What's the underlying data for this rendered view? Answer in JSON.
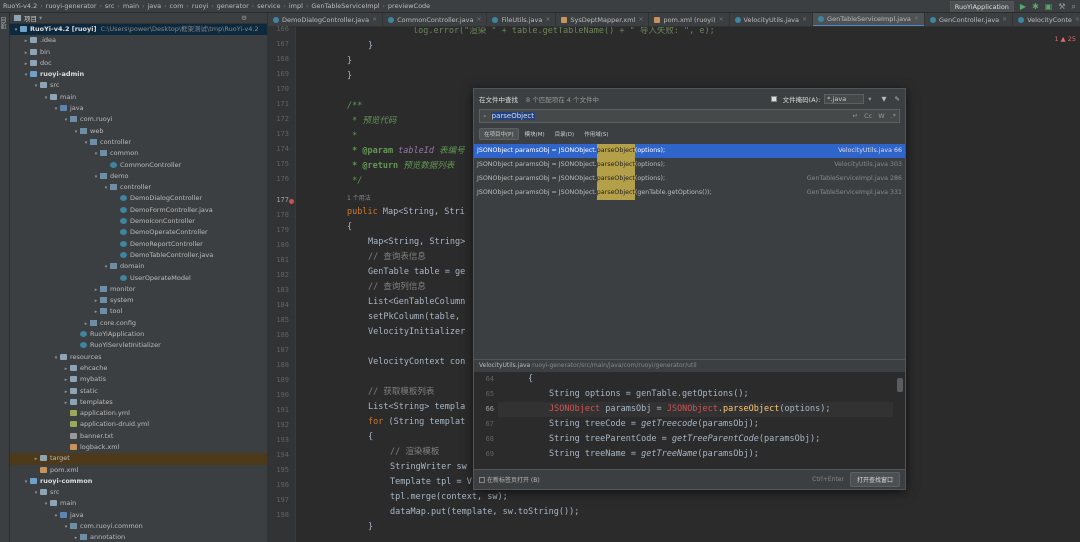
{
  "breadcrumbs": [
    "RuoYi-v4.2",
    "ruoyi-generator",
    "src",
    "main",
    "java",
    "com",
    "ruoyi",
    "generator",
    "service",
    "impl",
    "GenTableServiceImpl",
    "previewCode"
  ],
  "run_config": "RuoYiApplication",
  "project": {
    "header": "项目",
    "rows": [
      {
        "indent": 0,
        "arrow": "▾",
        "icon": "mod",
        "label": "RuoYi-v4.2 [ruoyi]",
        "extra": "C:\\Users\\power\\Desktop\\框架测试\\tmp\\RuoYi-v4.2",
        "bold": true,
        "selected": true
      },
      {
        "indent": 1,
        "arrow": "▸",
        "icon": "folder",
        "label": ".idea"
      },
      {
        "indent": 1,
        "arrow": "▸",
        "icon": "folder",
        "label": "bin"
      },
      {
        "indent": 1,
        "arrow": "▸",
        "icon": "folder",
        "label": "doc"
      },
      {
        "indent": 1,
        "arrow": "▾",
        "icon": "mod",
        "label": "ruoyi-admin",
        "bold": true
      },
      {
        "indent": 2,
        "arrow": "▾",
        "icon": "folder",
        "label": "src"
      },
      {
        "indent": 3,
        "arrow": "▾",
        "icon": "folder",
        "label": "main"
      },
      {
        "indent": 4,
        "arrow": "▾",
        "icon": "src",
        "label": "java"
      },
      {
        "indent": 5,
        "arrow": "▾",
        "icon": "pkg",
        "label": "com.ruoyi"
      },
      {
        "indent": 6,
        "arrow": "▾",
        "icon": "pkg",
        "label": "web"
      },
      {
        "indent": 7,
        "arrow": "▾",
        "icon": "pkg",
        "label": "controller"
      },
      {
        "indent": 8,
        "arrow": "▾",
        "icon": "pkg",
        "label": "common"
      },
      {
        "indent": 9,
        "arrow": "",
        "icon": "cls",
        "label": "CommonController"
      },
      {
        "indent": 8,
        "arrow": "▾",
        "icon": "pkg",
        "label": "demo"
      },
      {
        "indent": 9,
        "arrow": "▾",
        "icon": "pkg",
        "label": "controller"
      },
      {
        "indent": 10,
        "arrow": "",
        "icon": "cls",
        "label": "DemoDialogController"
      },
      {
        "indent": 10,
        "arrow": "",
        "icon": "cls",
        "label": "DemoFormController.java"
      },
      {
        "indent": 10,
        "arrow": "",
        "icon": "cls",
        "label": "DemoIconController"
      },
      {
        "indent": 10,
        "arrow": "",
        "icon": "cls",
        "label": "DemoOperateController"
      },
      {
        "indent": 10,
        "arrow": "",
        "icon": "cls",
        "label": "DemoReportController"
      },
      {
        "indent": 10,
        "arrow": "",
        "icon": "cls",
        "label": "DemoTableController.java"
      },
      {
        "indent": 9,
        "arrow": "▾",
        "icon": "pkg",
        "label": "domain"
      },
      {
        "indent": 10,
        "arrow": "",
        "icon": "cls",
        "label": "UserOperateModel"
      },
      {
        "indent": 8,
        "arrow": "▸",
        "icon": "pkg",
        "label": "monitor"
      },
      {
        "indent": 8,
        "arrow": "▸",
        "icon": "pkg",
        "label": "system"
      },
      {
        "indent": 8,
        "arrow": "▸",
        "icon": "pkg",
        "label": "tool"
      },
      {
        "indent": 7,
        "arrow": "▸",
        "icon": "pkg",
        "label": "core.config"
      },
      {
        "indent": 6,
        "arrow": "",
        "icon": "cls",
        "label": "RuoYiApplication"
      },
      {
        "indent": 6,
        "arrow": "",
        "icon": "cls",
        "label": "RuoYiServletInitializer"
      },
      {
        "indent": 4,
        "arrow": "▾",
        "icon": "folder",
        "label": "resources"
      },
      {
        "indent": 5,
        "arrow": "▸",
        "icon": "folder",
        "label": "ehcache"
      },
      {
        "indent": 5,
        "arrow": "▸",
        "icon": "folder",
        "label": "mybatis"
      },
      {
        "indent": 5,
        "arrow": "▸",
        "icon": "folder",
        "label": "static"
      },
      {
        "indent": 5,
        "arrow": "▸",
        "icon": "folder",
        "label": "templates"
      },
      {
        "indent": 5,
        "arrow": "",
        "icon": "yml",
        "label": "application.yml"
      },
      {
        "indent": 5,
        "arrow": "",
        "icon": "yml",
        "label": "application-druid.yml"
      },
      {
        "indent": 5,
        "arrow": "",
        "icon": "txt",
        "label": "banner.txt"
      },
      {
        "indent": 5,
        "arrow": "",
        "icon": "xml",
        "label": "logback.xml"
      },
      {
        "indent": 2,
        "arrow": "▸",
        "icon": "folder",
        "label": "target",
        "highlight": true
      },
      {
        "indent": 2,
        "arrow": "",
        "icon": "xml",
        "label": "pom.xml"
      },
      {
        "indent": 1,
        "arrow": "▾",
        "icon": "mod",
        "label": "ruoyi-common",
        "bold": true
      },
      {
        "indent": 2,
        "arrow": "▾",
        "icon": "folder",
        "label": "src"
      },
      {
        "indent": 3,
        "arrow": "▾",
        "icon": "folder",
        "label": "main"
      },
      {
        "indent": 4,
        "arrow": "▾",
        "icon": "src",
        "label": "java"
      },
      {
        "indent": 5,
        "arrow": "▾",
        "icon": "pkg",
        "label": "com.ruoyi.common"
      },
      {
        "indent": 6,
        "arrow": "▸",
        "icon": "pkg",
        "label": "annotation"
      }
    ]
  },
  "tabs": [
    {
      "label": "DemoDialogController.java",
      "type": "java"
    },
    {
      "label": "CommonController.java",
      "type": "java"
    },
    {
      "label": "FileUtils.java",
      "type": "java"
    },
    {
      "label": "SysDeptMapper.xml",
      "type": "xml"
    },
    {
      "label": "pom.xml (ruoyi)",
      "type": "xml"
    },
    {
      "label": "VelocityUtils.java",
      "type": "java"
    },
    {
      "label": "GenTableServiceImpl.java",
      "type": "java",
      "active": true
    },
    {
      "label": "GenController.java",
      "type": "java"
    },
    {
      "label": "VelocityConte",
      "type": "java"
    }
  ],
  "warning_count": "1 ▲ 25",
  "line_numbers": [
    "166",
    "167",
    "168",
    "169",
    "170",
    "171",
    "172",
    "173",
    "174",
    "175",
    "176",
    "177",
    "178",
    "179",
    "180",
    "181",
    "182",
    "183",
    "184",
    "185",
    "186",
    "187",
    "188",
    "189",
    "190",
    "191",
    "192",
    "193",
    "194",
    "195",
    "196",
    "197",
    "198"
  ],
  "current_line": "177",
  "usages_hint": "1 个用法",
  "code": {
    "l166": "log.error(\"渲染 \" + table.getTableName() + \" 导入失败: \", e);",
    "l167": "}",
    "l168": "}",
    "l171_open": "/**",
    "l172": " * 预览代码",
    "l173": " *",
    "l174_tag": " * @param",
    "l174_name": " tableId",
    "l174_desc": " 表编号",
    "l175_tag": " * @return",
    "l175_desc": " 预览数据列表",
    "l176": " */",
    "l177_kw": "public",
    "l177_rest": " Map<String, Stri",
    "l178": "{",
    "l179": "Map<String, String>",
    "l180": "// 查询表信息",
    "l181": "GenTable table = ge",
    "l182": "// 查询列信息",
    "l183": "List<GenTableColumn",
    "l184": "setPkColumn(table, ",
    "l185": "VelocityInitializer",
    "l187": "VelocityContext con",
    "l189": "// 获取模板列表",
    "l190": "List<String> templa",
    "l191_kw": "for",
    "l191_rest": " (String templat",
    "l192": "{",
    "l193": "// 渲染模板",
    "l194": "StringWriter sw",
    "l195": "Template tpl = V",
    "l196": "tpl.merge(context, sw);",
    "l197": "dataMap.put(template, sw.toString());",
    "l198": "}"
  },
  "find": {
    "title": "在文件中查找",
    "count": "8 个匹配项在 4 个文件中",
    "file_mask_label": "文件掩码(A):",
    "file_mask_value": "*.java",
    "query": "parseObject",
    "scopes": [
      "在项目中(P)",
      "模块(M)",
      "目录(D)",
      "作用域(S)"
    ],
    "results": [
      {
        "pre": "JSONObject paramsObj = JSONObject.",
        "match": "parseObject",
        "post": "(options);",
        "loc": "VelocityUtils.java 66",
        "selected": true
      },
      {
        "pre": "JSONObject paramsObj = JSONObject.",
        "match": "parseObject",
        "post": "(options);",
        "loc": "VelocityUtils.java 303"
      },
      {
        "pre": "JSONObject paramsObj = JSONObject.",
        "match": "parseObject",
        "post": "(options);",
        "loc": "GenTableServiceImpl.java 286"
      },
      {
        "pre": "JSONObject paramsObj = JSONObject.",
        "match": "parseObject",
        "post": "(genTable.getOptions());",
        "loc": "GenTableServiceImpl.java 331"
      }
    ],
    "preview_file": "VelocityUtils.java",
    "preview_path": "ruoyi-generator/src/main/java/com/ruoyi/generator/util",
    "preview_line_numbers": [
      "64",
      "65",
      "66",
      "67",
      "68",
      "69"
    ],
    "preview": {
      "p64": "{",
      "p65_a": "String options = genTable.getOptions();",
      "p66_a": "JSONObject",
      "p66_b": " paramsObj = ",
      "p66_c": "JSONObject",
      "p66_d": ".",
      "p66_e": "parseObject",
      "p66_f": "(options);",
      "p67_a": "String treeCode = ",
      "p67_b": "getTreecode",
      "p67_c": "(paramsObj);",
      "p68_a": "String treeParentCode = ",
      "p68_b": "getTreeParentCode",
      "p68_c": "(paramsObj);",
      "p69_a": "String treeName = ",
      "p69_b": "getTreeName",
      "p69_c": "(paramsObj);"
    },
    "footer_checkbox": "在新标签页打开 (B)",
    "shortcut": "Ctrl+Enter",
    "open_button": "打开查找窗口"
  },
  "colors": {
    "accent": "#2f65ca",
    "match": "#b5a04a",
    "bg": "#2b2b2b",
    "panel": "#3c3f41"
  }
}
